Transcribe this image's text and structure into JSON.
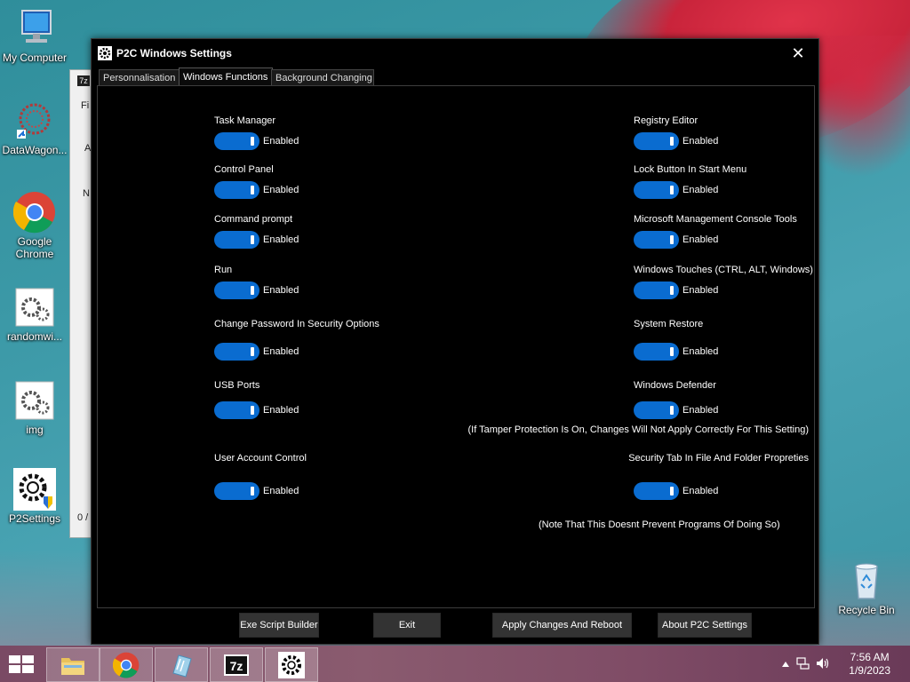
{
  "desktop": {
    "icons": [
      {
        "label": "My Computer"
      },
      {
        "label": "DataWagon..."
      },
      {
        "label": "Google Chrome"
      },
      {
        "label": "randomwi..."
      },
      {
        "label": "img"
      },
      {
        "label": "P2Settings"
      },
      {
        "label": "Recycle Bin"
      }
    ]
  },
  "bg_window": {
    "title_prefix": "7z",
    "rows": [
      "Fi",
      "A",
      "N",
      "0 /"
    ]
  },
  "window": {
    "title": "P2C Windows Settings",
    "close": "✕",
    "tabs": [
      {
        "label": "Personnalisation",
        "active": false
      },
      {
        "label": "Windows Functions",
        "active": true
      },
      {
        "label": "Background Changing",
        "active": false
      }
    ]
  },
  "settings": {
    "left": [
      {
        "label": "Task Manager",
        "state": "Enabled"
      },
      {
        "label": "Control Panel",
        "state": "Enabled"
      },
      {
        "label": "Command prompt",
        "state": "Enabled"
      },
      {
        "label": "Run",
        "state": "Enabled"
      },
      {
        "label": "Change Password In Security Options",
        "state": "Enabled"
      },
      {
        "label": "USB Ports",
        "state": "Enabled"
      },
      {
        "label": "User Account Control",
        "state": "Enabled"
      }
    ],
    "right": [
      {
        "label": "Registry Editor",
        "state": "Enabled"
      },
      {
        "label": "Lock Button In Start Menu",
        "state": "Enabled"
      },
      {
        "label": "Microsoft Management Console Tools",
        "state": "Enabled"
      },
      {
        "label": "Windows Touches (CTRL, ALT, Windows)",
        "state": "Enabled"
      },
      {
        "label": "System Restore",
        "state": "Enabled"
      },
      {
        "label": "Windows Defender",
        "state": "Enabled"
      },
      {
        "label": "Security Tab In File And Folder Propreties",
        "state": "Enabled"
      }
    ],
    "notes": {
      "defender": "(If Tamper Protection Is On, Changes Will Not Apply Correctly For This Setting)",
      "security_tab": "(Note That This Doesnt Prevent Programs Of Doing So)"
    }
  },
  "buttons": {
    "exe_builder": "Exe Script Builder",
    "exit": "Exit",
    "apply": "Apply Changes And Reboot",
    "about": "About P2C Settings"
  },
  "taskbar": {
    "items": [
      "file-explorer-icon",
      "chrome-icon",
      "notepad-icon",
      "7zip-icon",
      "p2settings-gear-icon"
    ],
    "time": "7:56 AM",
    "date": "1/9/2023"
  },
  "colors": {
    "toggle_on": "#0a6cd0",
    "window_bg": "#000000",
    "button_bg": "#333333"
  }
}
